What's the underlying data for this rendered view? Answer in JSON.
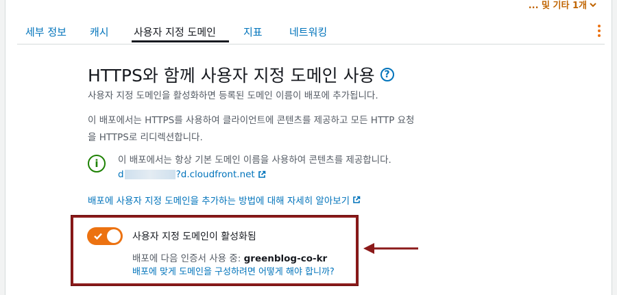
{
  "header": {
    "more_label": "... 및 기타 1개"
  },
  "tabs": [
    {
      "label": "세부 정보",
      "active": false
    },
    {
      "label": "캐시",
      "active": false
    },
    {
      "label": "사용자 지정 도메인",
      "active": true
    },
    {
      "label": "지표",
      "active": false
    },
    {
      "label": "네트워킹",
      "active": false
    }
  ],
  "section": {
    "title": "HTTPS와 함께 사용자 지정 도메인 사용",
    "desc1": "사용자 지정 도메인을 활성화하면 등록된 도메인 이름이 배포에 추가됩니다.",
    "desc2_line1": "이 배포에서는 HTTPS를 사용하여 클라이언트에 콘텐츠를 제공하고 모든 HTTP 요청",
    "desc2_line2": "을 HTTPS로 리디렉션합니다.",
    "info_text": "이 배포에서는 항상 기본 도메인 이름을 사용하여 콘텐츠를 제공합니다.",
    "domain_prefix": "d",
    "domain_suffix": "?d.cloudfront.net",
    "learn_more": "배포에 사용자 지정 도메인을 추가하는 방법에 대해 자세히 알아보기"
  },
  "toggle": {
    "enabled": true,
    "label": "사용자 지정 도메인이 활성화됨",
    "cert_prefix": "배포에 다음 인증서 사용 중: ",
    "cert_name": "greenblog-co-kr",
    "how_link": "배포에 맞게 도메인을 구성하려면 어떻게 해야 합니까?"
  },
  "colors": {
    "accent": "#ec7211",
    "link": "#0073bb",
    "success": "#1d8102",
    "annotation": "#8b1a1a"
  }
}
